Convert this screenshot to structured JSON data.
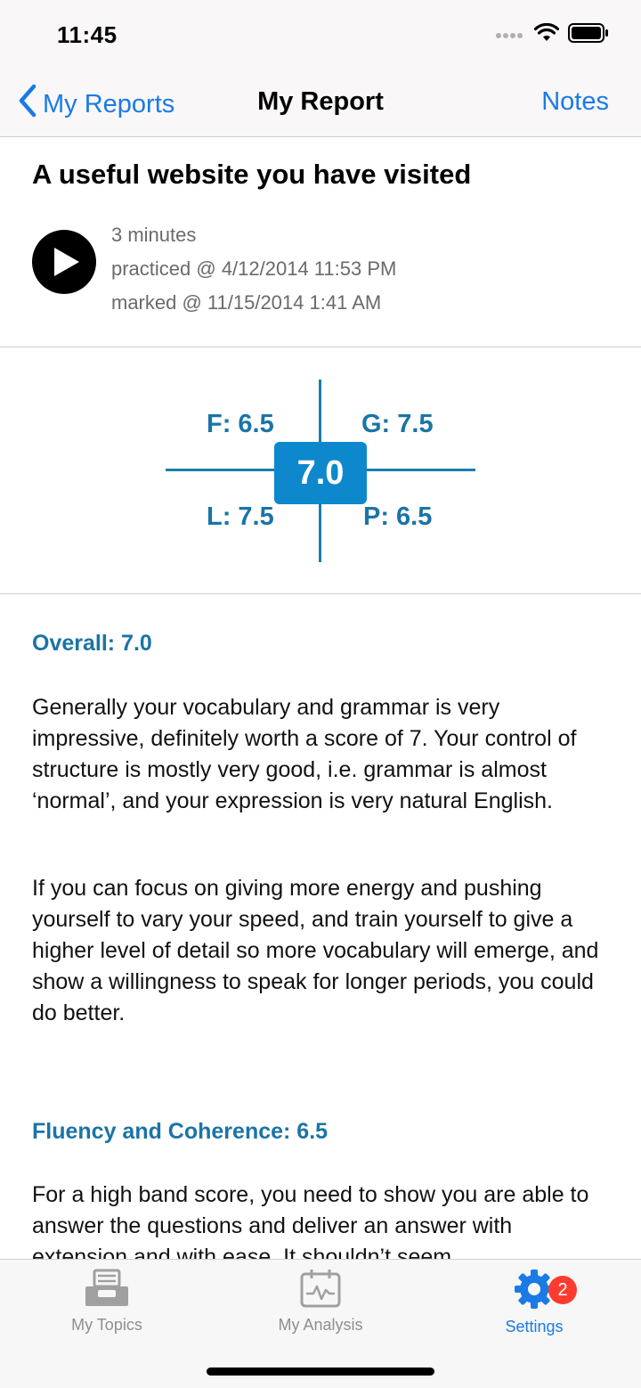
{
  "status_bar": {
    "time": "11:45"
  },
  "nav": {
    "back_label": "My Reports",
    "title": "My Report",
    "notes_label": "Notes"
  },
  "report": {
    "topic_title": "A useful website you have visited",
    "duration": "3 minutes",
    "practiced": "practiced @ 4/12/2014 11:53 PM",
    "marked": "marked @ 11/15/2014 1:41 AM"
  },
  "scores": {
    "overall": "7.0",
    "f": "F: 6.5",
    "g": "G: 7.5",
    "l": "L: 7.5",
    "p": "P: 6.5"
  },
  "sections": [
    {
      "heading": "Overall: 7.0",
      "paragraphs": [
        "Generally your vocabulary and grammar is very impressive, definitely worth a score of 7. Your control of structure is mostly very good, i.e. grammar is almost ‘normal’, and your expression is very natural English.",
        "If you can focus on giving more energy and pushing yourself to vary your speed, and train yourself to give a higher level of detail so more vocabulary will emerge, and show a willingness to speak for longer periods, you could do better."
      ]
    },
    {
      "heading": "Fluency and Coherence: 6.5",
      "paragraphs": [
        "For a high band score, you need to show you are able to answer the questions and deliver an answer with extension and with ease. It shouldn’t seem"
      ]
    }
  ],
  "tabs": [
    {
      "label": "My Topics",
      "icon": "inbox-tray-icon"
    },
    {
      "label": "My Analysis",
      "icon": "calendar-chart-icon"
    },
    {
      "label": "Settings",
      "icon": "gear-icon",
      "badge": "2",
      "active": true
    }
  ],
  "colors": {
    "accent": "#1a7ae6",
    "score_blue": "#0e88cc",
    "heading_blue": "#1a74a6",
    "badge": "#ff3b30"
  }
}
